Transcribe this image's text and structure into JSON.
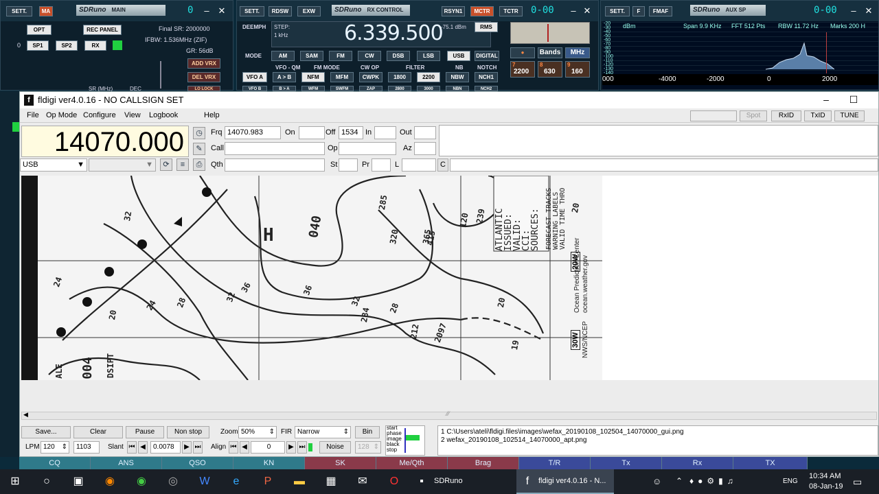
{
  "sdr_main": {
    "sett": "SETT.",
    "ma": "MA",
    "title": "SDRuno",
    "sub": "MAIN",
    "lcd": "0",
    "opt": "OPT",
    "rec": "REC PANEL",
    "zero": "0",
    "sp1": "SP1",
    "sp2": "SP2",
    "rx": "RX",
    "final_sr": "Final SR: 2000000",
    "ifbw": "IFBW: 1.536MHz (ZIF)",
    "gr": "GR: 56dB",
    "add_vrx": "ADD VRX",
    "del_vrx": "DEL VRX",
    "lo_lock": "LO LOCK",
    "sr_mhz": "SR (MHz)",
    "dec": "DEC"
  },
  "sdr_rx": {
    "sett": "SETT.",
    "rdsw": "RDSW",
    "exw": "EXW",
    "title": "SDRuno",
    "sub": "RX CONTROL",
    "rsyn": "RSYN1",
    "mctr": "MCTR",
    "tctr": "TCTR",
    "lcd": "0-00",
    "deemph": "DEEMPH",
    "step": "STEP:",
    "step_val": "1 kHz",
    "freq": "6.339.500",
    "dbm": "-75.1 dBm",
    "rms": "RMS",
    "mode": "MODE",
    "modes": [
      "AM",
      "SAM",
      "FM",
      "CW",
      "DSB",
      "LSB",
      "USB",
      "DIGITAL"
    ],
    "vfo_qm": "VFO - QM",
    "fm_mode": "FM MODE",
    "cw_op": "CW OP",
    "filter": "FILTER",
    "nb": "NB",
    "notch": "NOTCH",
    "vfoa": "VFO A",
    "ab": "A > B",
    "nfm": "NFM",
    "mfm": "MFM",
    "cwpk": "CWPK",
    "f1800": "1800",
    "f2200": "2200",
    "nbw": "NBW",
    "nch1": "NCH1",
    "vfob": "VFO B",
    "ba": "B > A",
    "wfm": "WFM",
    "swfm": "SWFM",
    "zap": "ZAP",
    "f2800": "2800",
    "f3000": "3000",
    "nbn": "NBN",
    "nch2": "NCH2",
    "bands": "Bands",
    "mhz": "MHz",
    "k7": "7",
    "k8": "8",
    "k9": "9",
    "v2200": "2200",
    "v630": "630",
    "v160": "160"
  },
  "sdr_sp": {
    "sett": "SETT.",
    "f": "F",
    "fmaf": "FMAF",
    "title": "SDRuno",
    "sub": "AUX SP",
    "lcd": "0-00",
    "dbm": "dBm",
    "span": "Span 9.9 KHz",
    "fft": "FFT 512 Pts",
    "rbw": "RBW 11.72 Hz",
    "marks": "Marks 200 H",
    "ylabels": [
      "-20",
      "-30",
      "-40",
      "-50",
      "-60",
      "-70",
      "-80",
      "-90",
      "-100",
      "-110",
      "-120",
      "-130",
      "-140"
    ],
    "xlabels": [
      "000",
      "-4000",
      "-2000",
      "0",
      "2000"
    ]
  },
  "fl": {
    "title": "fldigi ver4.0.16 - NO CALLSIGN SET",
    "menu": {
      "file": "File",
      "opmode": "Op Mode",
      "configure": "Configure",
      "view": "View",
      "logbook": "Logbook",
      "help": "Help"
    },
    "spot": "Spot",
    "rxid": "RxID",
    "txid": "TxID",
    "tune": "TUNE",
    "freq": "14070.000",
    "mode": "USB",
    "frq_lbl": "Frq",
    "frq": "14070.983",
    "on_lbl": "On",
    "on": "",
    "off_lbl": "Off",
    "off": "1534",
    "in_lbl": "In",
    "in": "",
    "out_lbl": "Out",
    "out": "",
    "call_lbl": "Call",
    "call": "",
    "op_lbl": "Op",
    "op": "",
    "az_lbl": "Az",
    "az": "",
    "qth_lbl": "Qth",
    "qth": "",
    "st_lbl": "St",
    "st": "",
    "pr_lbl": "Pr",
    "pr": "",
    "l_lbl": "L",
    "l": "",
    "c_lbl": "C",
    "c": "",
    "fax": {
      "labels": [
        "32",
        "24",
        "20",
        "28",
        "24",
        "32",
        "36",
        "36",
        "32",
        "20",
        "284",
        "28",
        "212",
        "2097",
        "239",
        "19",
        "20",
        "040",
        "004",
        "DSIPT",
        "ALE",
        "H",
        "285",
        "320",
        "365",
        "415",
        "120"
      ],
      "block1": "ATLANTIC\nISSUED:\nVALID:\nCCI:\nSOURCES:",
      "block2": "FORECAST TRACKS\nWARNING LABELS\nVALID TIME THRO",
      "ocean": "Ocean Prediction Center\nocean.weather.gov",
      "nws": "NWS/NCEP",
      "w20": "20W",
      "w30": "30W"
    },
    "ctl": {
      "save": "Save...",
      "clear": "Clear",
      "pause": "Pause",
      "nonstop": "Non stop",
      "zoom_lbl": "Zoom",
      "zoom": "50%",
      "fir_lbl": "FIR",
      "fir": "Narrow",
      "bin": "Bin",
      "lpm_lbl": "LPM",
      "lpm": "120",
      "lines": "1103",
      "slant_lbl": "Slant",
      "slant": "0.0078",
      "align_lbl": "Align",
      "align": "0",
      "noise": "Noise",
      "v128": "128"
    },
    "status": [
      "start",
      "phase",
      "image",
      "black",
      "stop"
    ],
    "log": [
      "1 C:\\Users\\ateli\\fldigi.files\\images\\wefax_20190108_102504_14070000_gui.png",
      "2 wefax_20190108_102514_14070000_apt.png"
    ]
  },
  "macros": [
    "CQ",
    "ANS",
    "QSO",
    "KN",
    "SK",
    "Me/Qth",
    "Brag",
    "T/R",
    "Tx",
    "Rx",
    "TX"
  ],
  "taskbar": {
    "sdruno": "SDRuno",
    "fldigi": "fldigi ver4.0.16 - N...",
    "lang": "ENG",
    "time": "10:34 AM",
    "date": "08-Jan-19"
  },
  "colors": {
    "accent_orange": "#c8502a",
    "lcd_cyan": "#20e0e0",
    "freq_bg": "#fffbe0",
    "macro_teal": "#2f7a8a",
    "macro_red": "#8a3a4a",
    "macro_blue": "#3a4a9a",
    "tuning_green": "#20d040"
  }
}
